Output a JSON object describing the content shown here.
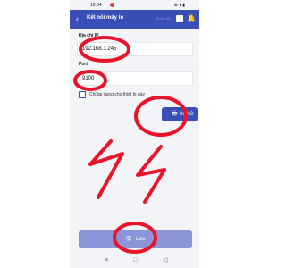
{
  "status_bar": {
    "time": "18:34",
    "right_icons": "⊕ ▾ ▮"
  },
  "app_bar": {
    "back_icon": "‹",
    "title": "Kết nối máy in",
    "version": "v2.3.8.10",
    "bell_icon": "🔔"
  },
  "form": {
    "ip_label": "Địa chỉ IP",
    "ip_value": "192.168.1.245",
    "port_label": "Port",
    "port_value": "9100",
    "apply_checkbox_label": "Chỉ áp dụng cho thiết bị này",
    "apply_checked": false
  },
  "buttons": {
    "print_label": "In thử",
    "save_label": "Lưu",
    "print_icon": "🖶",
    "save_icon": "🖫"
  },
  "navigation_bar": {
    "menu_icon": "≡",
    "home_icon": "□",
    "back_icon": "◁"
  },
  "colors": {
    "primary": "#3a4eb8",
    "annotation": "#e8152a",
    "save_disabled": "#8a96d8"
  }
}
